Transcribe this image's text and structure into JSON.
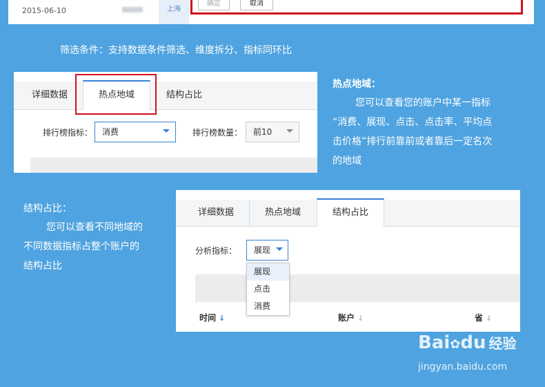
{
  "top_row": {
    "date": "2015-06-10",
    "user": "gaojun",
    "city": "上海",
    "confirm_label": "确定",
    "cancel_label": "取消"
  },
  "filter_note": "筛选条件：支持数据条件筛选、维度拆分、指标同环比",
  "hotspot_panel": {
    "tabs": [
      "详细数据",
      "热点地域",
      "结构占比"
    ],
    "active_tab": "热点地域",
    "metric_label": "排行榜指标：",
    "metric_value": "消费",
    "count_label": "排行榜数量：",
    "count_value": "前10"
  },
  "hotspot_note": {
    "title": "热点地域：",
    "lines": [
      "您可以查看您的账户中某一指标",
      "“消费、展现、点击、点击率、平均点",
      "击价格”排行前靠前或者靠后一定名次",
      "的地域"
    ]
  },
  "structure_note": {
    "title": "结构占比：",
    "lines": [
      "您可以查看不同地域的",
      "不同数据指标占整个账户的",
      "结构占比"
    ]
  },
  "structure_panel": {
    "tabs": [
      "详细数据",
      "热点地域",
      "结构占比"
    ],
    "active_tab": "结构占比",
    "metric_label": "分析指标：",
    "metric_value": "展现",
    "dropdown_options": [
      "展现",
      "点击",
      "消费"
    ],
    "columns": [
      "时间",
      "账户",
      "省"
    ]
  },
  "watermark": {
    "brand": "Bai",
    "brand2": "du",
    "product": "经验",
    "url": "jingyan.baidu.com"
  },
  "colors": {
    "background": "#4fa3e0",
    "highlight_red": "#d0101a",
    "accent_blue": "#3a7fd5"
  }
}
